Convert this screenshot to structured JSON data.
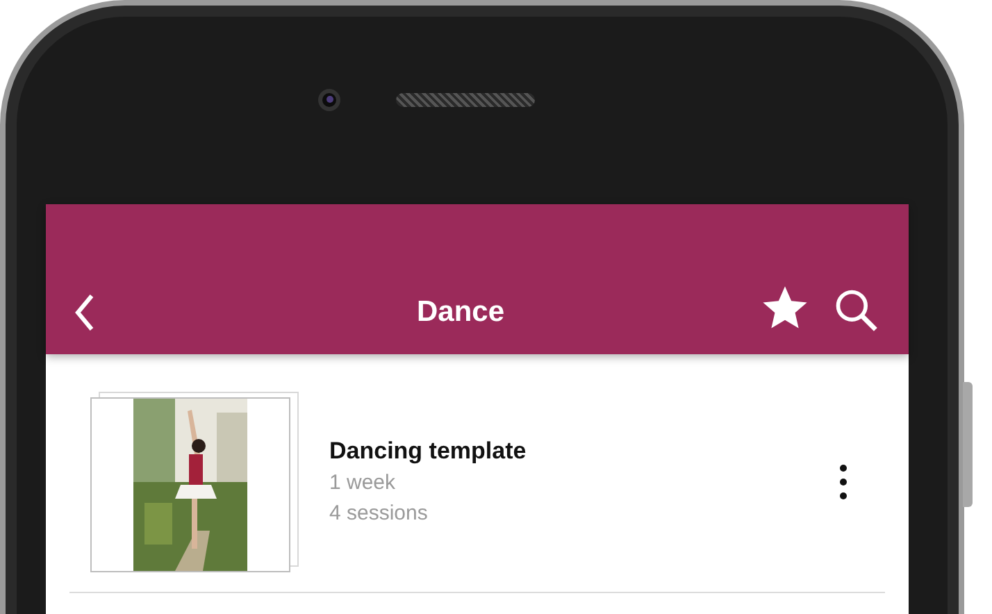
{
  "header": {
    "title": "Dance"
  },
  "templates": [
    {
      "kind": "picture",
      "title": "Dancing template",
      "duration": "1 week",
      "sessions": "4 sessions"
    }
  ]
}
